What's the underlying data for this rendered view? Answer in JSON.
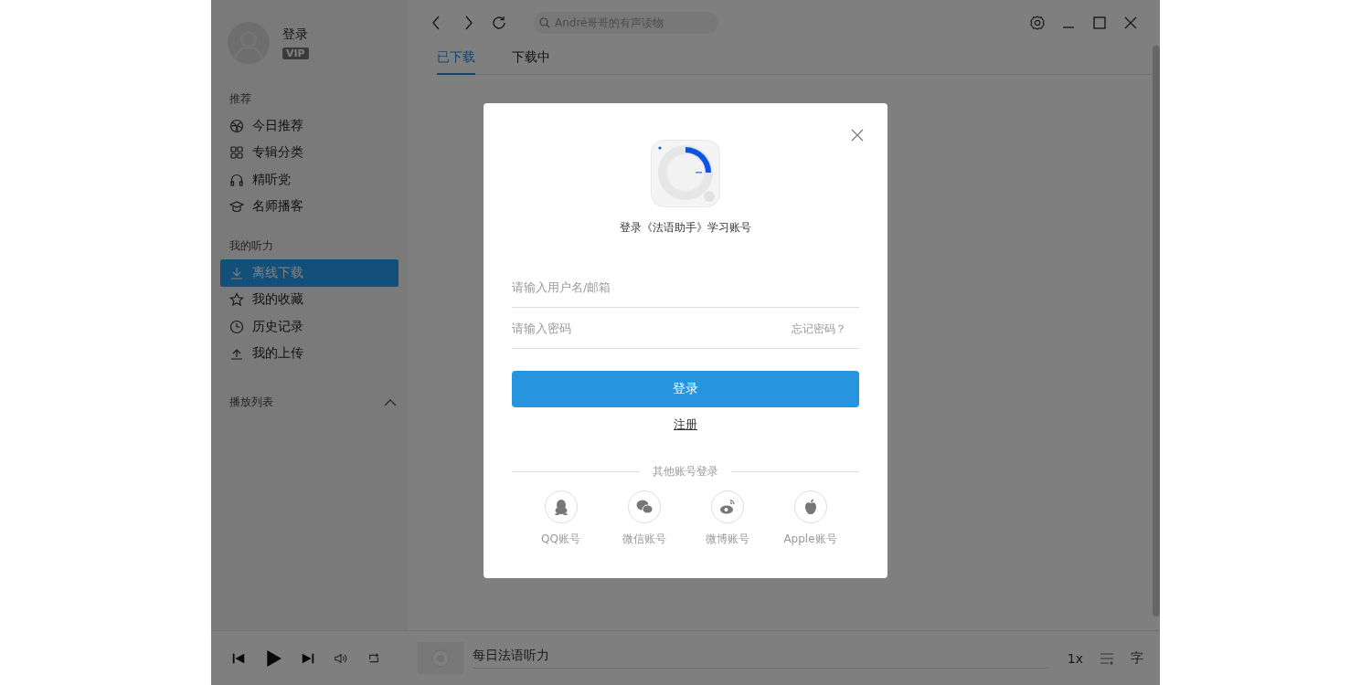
{
  "sidebar": {
    "user": {
      "name": "登录",
      "badge": "VIP"
    },
    "sections": [
      {
        "title": "推荐",
        "items": [
          {
            "label": "今日推荐",
            "kind": "ball",
            "selected": false
          },
          {
            "label": "专辑分类",
            "kind": "grid",
            "selected": false
          },
          {
            "label": "精听党",
            "kind": "headphones",
            "selected": false
          },
          {
            "label": "名师播客",
            "kind": "cap",
            "selected": false
          }
        ]
      },
      {
        "title": "我的听力",
        "items": [
          {
            "label": "离线下载",
            "kind": "download",
            "selected": true
          },
          {
            "label": "我的收藏",
            "kind": "star",
            "selected": false
          },
          {
            "label": "历史记录",
            "kind": "clock",
            "selected": false
          },
          {
            "label": "我的上传",
            "kind": "upload",
            "selected": false
          }
        ]
      }
    ],
    "playlist": {
      "title": "播放列表",
      "expanded": true
    }
  },
  "toolbar": {
    "search": {
      "placeholder": "André哥哥的有声读物"
    }
  },
  "tabs": [
    {
      "label": "已下载",
      "selected": true
    },
    {
      "label": "下载中",
      "selected": false
    }
  ],
  "player": {
    "track": "每日法语听力",
    "speed": "1x",
    "lyrics": "字"
  },
  "dialog": {
    "subtitle": "登录《法语助手》学习账号",
    "username": {
      "placeholder": "请输入用户名/邮箱"
    },
    "password": {
      "placeholder": "请输入密码"
    },
    "forgot": "忘记密码？",
    "login_button": "登录",
    "register": "注册",
    "divider": "其他账号登录",
    "providers": [
      {
        "label": "QQ账号",
        "kind": "qq"
      },
      {
        "label": "微信账号",
        "kind": "wechat"
      },
      {
        "label": "微博账号",
        "kind": "weibo"
      },
      {
        "label": "Apple账号",
        "kind": "apple"
      }
    ]
  }
}
